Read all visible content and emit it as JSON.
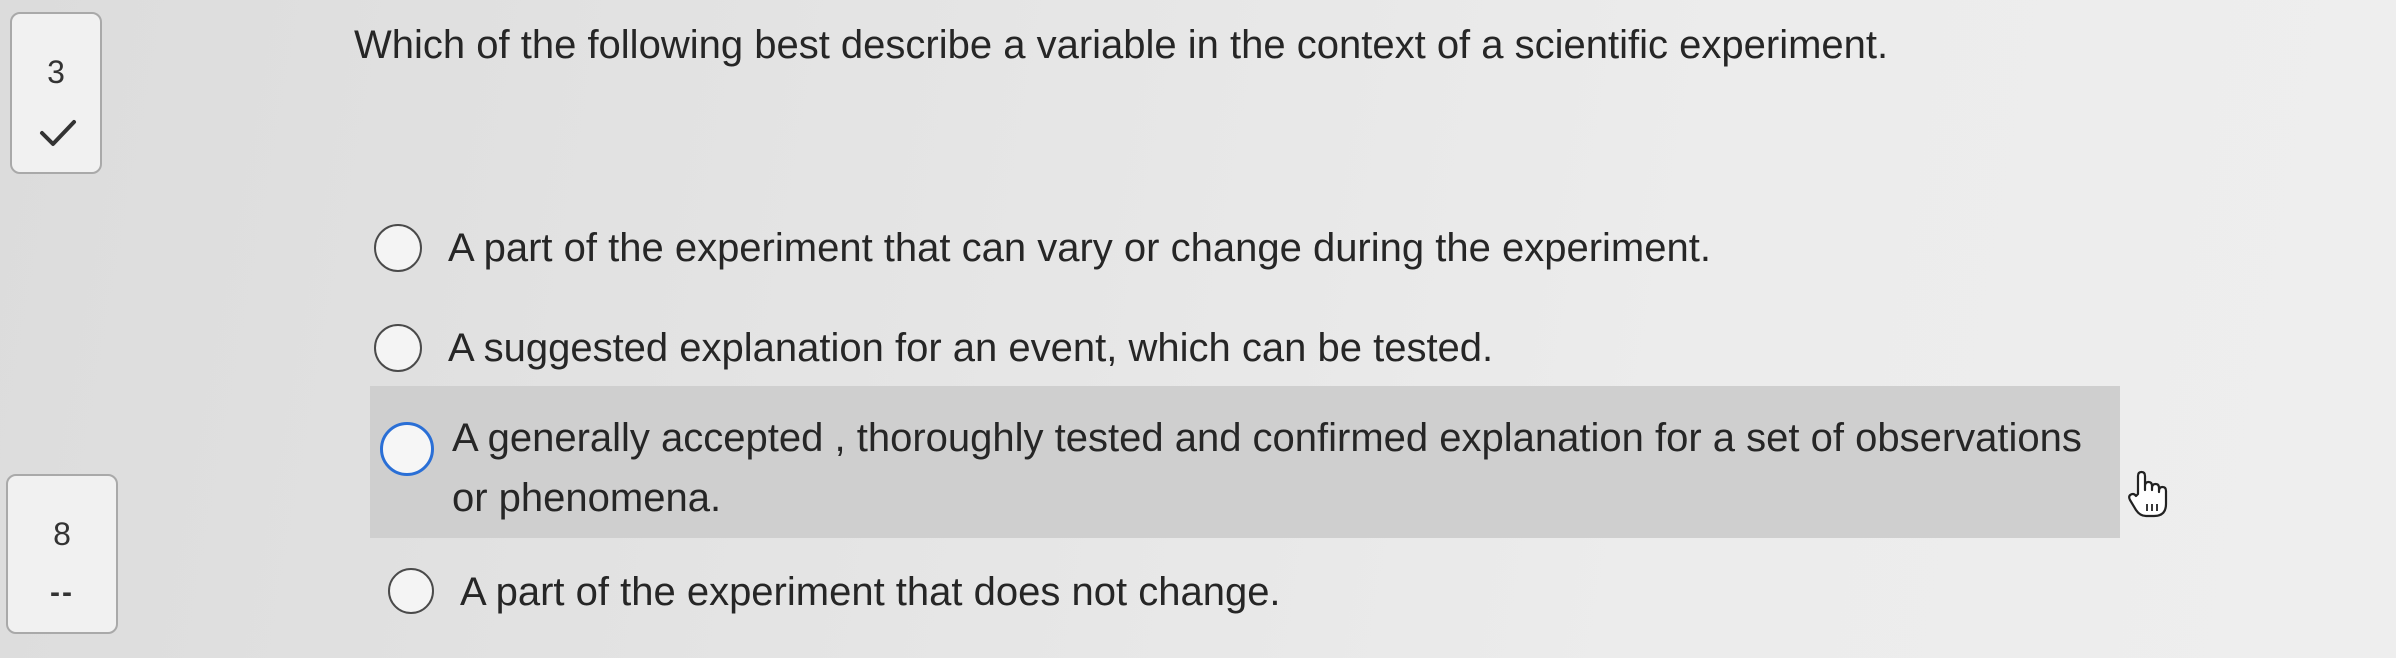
{
  "navigator": {
    "items": [
      {
        "number": "3",
        "status_icon": "check-icon"
      },
      {
        "number": "8",
        "status_text": "--"
      }
    ]
  },
  "question": {
    "text": "Which of the following best describe a variable in the context of a scientific experiment."
  },
  "options": [
    {
      "label": "A part of the experiment that can vary or change during the experiment.",
      "selected": false
    },
    {
      "label": "A suggested explanation for an event, which can be tested.",
      "selected": false
    },
    {
      "label": "A generally accepted , thoroughly tested and confirmed explanation for a set of observations or phenomena.",
      "selected": false,
      "hovered": true
    },
    {
      "label": "A part of the experiment that does not change.",
      "selected": false
    }
  ],
  "colors": {
    "focus_ring": "#2a6fd6",
    "hover_background": "#cfcfcf"
  },
  "cursor_icon": "hand-pointer-icon"
}
